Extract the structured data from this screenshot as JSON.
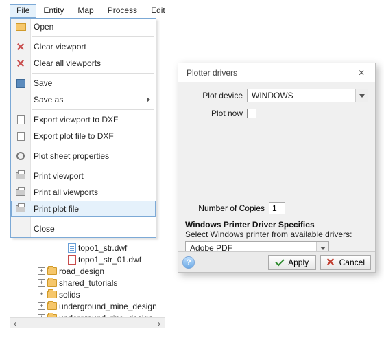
{
  "menubar": {
    "items": [
      {
        "label": "File"
      },
      {
        "label": "Entity"
      },
      {
        "label": "Map"
      },
      {
        "label": "Process"
      },
      {
        "label": "Edit"
      }
    ]
  },
  "file_menu": {
    "open": "Open",
    "clear_viewport": "Clear viewport",
    "clear_all_viewports": "Clear all viewports",
    "save": "Save",
    "save_as": "Save as",
    "export_viewport_dxf": "Export viewport to DXF",
    "export_plotfile_dxf": "Export plot file to DXF",
    "plot_sheet_props": "Plot sheet properties",
    "print_viewport": "Print viewport",
    "print_all_viewports": "Print all viewports",
    "print_plot_file": "Print plot file",
    "close": "Close"
  },
  "tree": {
    "files": [
      {
        "name": "topo1_str.dwf"
      },
      {
        "name": "topo1_str_01.dwf"
      }
    ],
    "folders": [
      {
        "name": "road_design"
      },
      {
        "name": "shared_tutorials"
      },
      {
        "name": "solids"
      },
      {
        "name": "underground_mine_design"
      },
      {
        "name": "underground_ring_design"
      }
    ]
  },
  "dialog": {
    "title": "Plotter drivers",
    "plot_device_label": "Plot device",
    "plot_device_value": "WINDOWS",
    "plot_now_label": "Plot now",
    "copies_label": "Number of Copies",
    "copies_value": "1",
    "section_title": "Windows Printer Driver Specifics",
    "section_sub": "Select Windows printer from available drivers:",
    "printer_value": "Adobe PDF",
    "apply": "Apply",
    "cancel": "Cancel"
  }
}
